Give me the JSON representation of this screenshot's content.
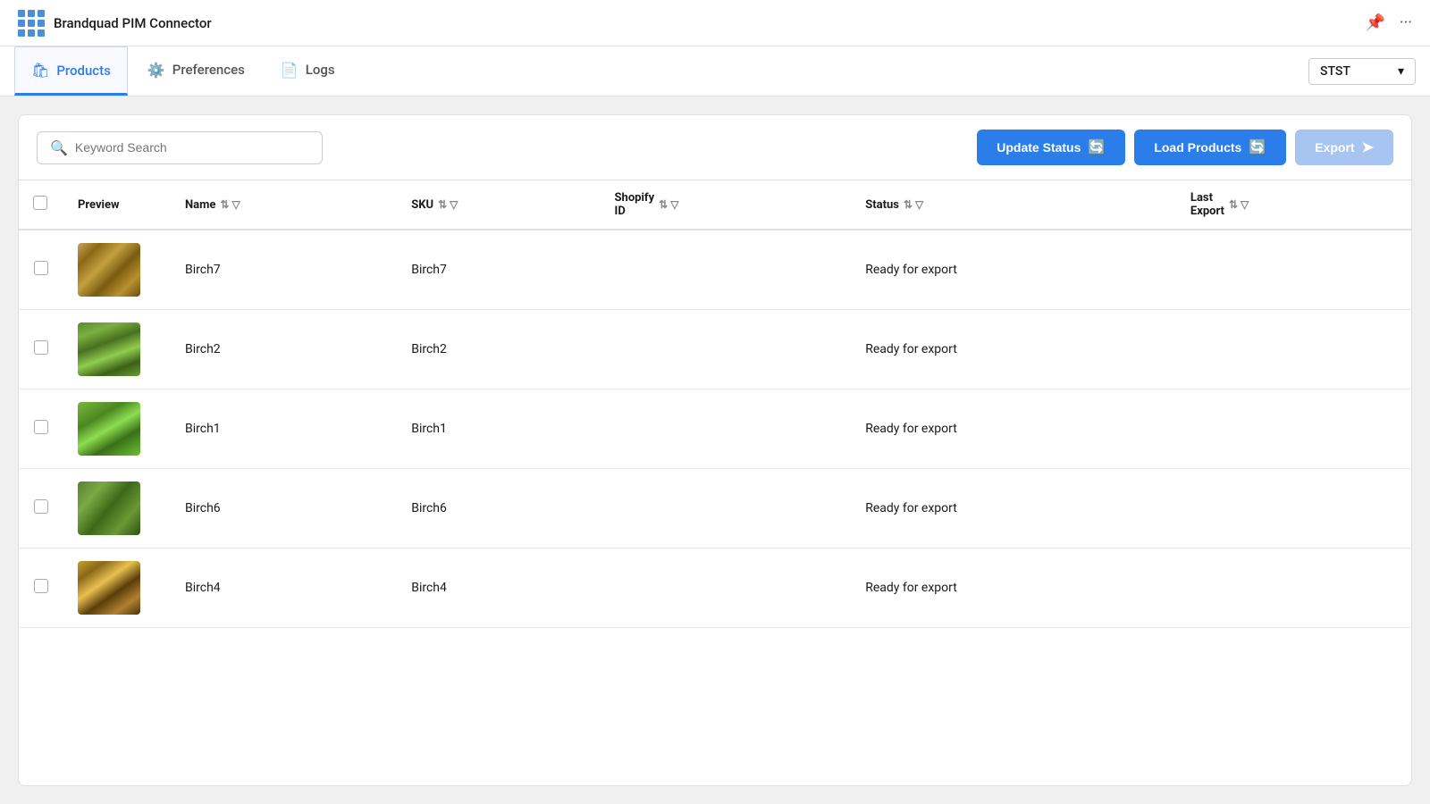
{
  "app": {
    "title": "Brandquad PIM Connector"
  },
  "nav": {
    "tabs": [
      {
        "id": "products",
        "label": "Products",
        "icon": "🛍",
        "active": true
      },
      {
        "id": "preferences",
        "label": "Preferences",
        "icon": "⚙",
        "active": false
      },
      {
        "id": "logs",
        "label": "Logs",
        "icon": "📄",
        "active": false
      }
    ],
    "store_selector": {
      "value": "STST",
      "options": [
        "STST"
      ]
    }
  },
  "toolbar": {
    "search_placeholder": "Keyword Search",
    "update_status_label": "Update Status",
    "load_products_label": "Load Products",
    "export_label": "Export"
  },
  "table": {
    "columns": [
      {
        "id": "preview",
        "label": "Preview",
        "sortable": false,
        "filterable": false
      },
      {
        "id": "name",
        "label": "Name",
        "sortable": true,
        "filterable": true
      },
      {
        "id": "sku",
        "label": "SKU",
        "sortable": true,
        "filterable": true
      },
      {
        "id": "shopify_id",
        "label": "Shopify ID",
        "sortable": true,
        "filterable": true
      },
      {
        "id": "status",
        "label": "Status",
        "sortable": true,
        "filterable": true
      },
      {
        "id": "last_export",
        "label": "Last Export",
        "sortable": true,
        "filterable": true
      }
    ],
    "rows": [
      {
        "id": 1,
        "name": "Birch7",
        "sku": "Birch7",
        "shopify_id": "",
        "status": "Ready for export",
        "last_export": "",
        "thumb_class": "thumb-birch7"
      },
      {
        "id": 2,
        "name": "Birch2",
        "sku": "Birch2",
        "shopify_id": "",
        "status": "Ready for export",
        "last_export": "",
        "thumb_class": "thumb-birch2"
      },
      {
        "id": 3,
        "name": "Birch1",
        "sku": "Birch1",
        "shopify_id": "",
        "status": "Ready for export",
        "last_export": "",
        "thumb_class": "thumb-birch1"
      },
      {
        "id": 4,
        "name": "Birch6",
        "sku": "Birch6",
        "shopify_id": "",
        "status": "Ready for export",
        "last_export": "",
        "thumb_class": "thumb-birch6"
      },
      {
        "id": 5,
        "name": "Birch4",
        "sku": "Birch4",
        "shopify_id": "",
        "status": "Ready for export",
        "last_export": "",
        "thumb_class": "thumb-birch4"
      }
    ]
  }
}
